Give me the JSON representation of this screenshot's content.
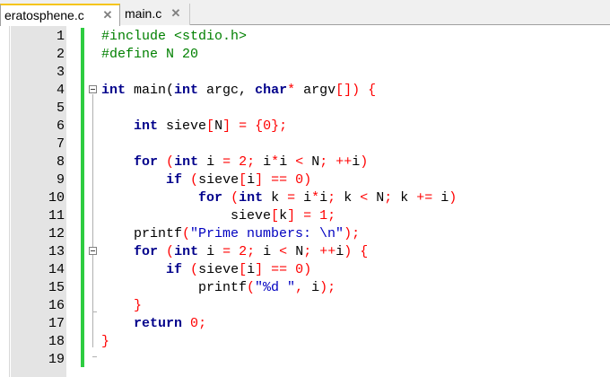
{
  "tabs": [
    {
      "label": "eratosphene.c",
      "close": "✕"
    },
    {
      "label": "main.c",
      "close": "✕"
    }
  ],
  "editor": {
    "lines": [
      {
        "n": "1",
        "tokens": [
          {
            "t": "#include <stdio.h>",
            "c": "pp"
          }
        ]
      },
      {
        "n": "2",
        "tokens": [
          {
            "t": "#define N 20",
            "c": "pp"
          }
        ]
      },
      {
        "n": "3",
        "tokens": []
      },
      {
        "n": "4",
        "tokens": [
          {
            "t": "int",
            "c": "kw"
          },
          {
            "t": " main(",
            "c": ""
          },
          {
            "t": "int",
            "c": "kw"
          },
          {
            "t": " argc, ",
            "c": ""
          },
          {
            "t": "char",
            "c": "kw"
          },
          {
            "t": "*",
            "c": "op"
          },
          {
            "t": " argv",
            "c": ""
          },
          {
            "t": "[])",
            "c": "op"
          },
          {
            "t": " ",
            "c": ""
          },
          {
            "t": "{",
            "c": "op"
          }
        ]
      },
      {
        "n": "5",
        "tokens": []
      },
      {
        "n": "6",
        "tokens": [
          {
            "t": "    ",
            "c": ""
          },
          {
            "t": "int",
            "c": "kw"
          },
          {
            "t": " sieve",
            "c": ""
          },
          {
            "t": "[",
            "c": "op"
          },
          {
            "t": "N",
            "c": ""
          },
          {
            "t": "]",
            "c": "op"
          },
          {
            "t": " ",
            "c": ""
          },
          {
            "t": "=",
            "c": "op"
          },
          {
            "t": " ",
            "c": ""
          },
          {
            "t": "{",
            "c": "op"
          },
          {
            "t": "0",
            "c": "num"
          },
          {
            "t": "};",
            "c": "op"
          }
        ]
      },
      {
        "n": "7",
        "tokens": []
      },
      {
        "n": "8",
        "tokens": [
          {
            "t": "    ",
            "c": ""
          },
          {
            "t": "for",
            "c": "kw"
          },
          {
            "t": " ",
            "c": ""
          },
          {
            "t": "(",
            "c": "op"
          },
          {
            "t": "int",
            "c": "kw"
          },
          {
            "t": " i ",
            "c": ""
          },
          {
            "t": "=",
            "c": "op"
          },
          {
            "t": " ",
            "c": ""
          },
          {
            "t": "2",
            "c": "num"
          },
          {
            "t": ";",
            "c": "op"
          },
          {
            "t": " i",
            "c": ""
          },
          {
            "t": "*",
            "c": "op"
          },
          {
            "t": "i ",
            "c": ""
          },
          {
            "t": "<",
            "c": "op"
          },
          {
            "t": " N",
            "c": ""
          },
          {
            "t": ";",
            "c": "op"
          },
          {
            "t": " ",
            "c": ""
          },
          {
            "t": "++",
            "c": "op"
          },
          {
            "t": "i",
            "c": ""
          },
          {
            "t": ")",
            "c": "op"
          }
        ]
      },
      {
        "n": "9",
        "tokens": [
          {
            "t": "        ",
            "c": ""
          },
          {
            "t": "if",
            "c": "kw"
          },
          {
            "t": " ",
            "c": ""
          },
          {
            "t": "(",
            "c": "op"
          },
          {
            "t": "sieve",
            "c": ""
          },
          {
            "t": "[",
            "c": "op"
          },
          {
            "t": "i",
            "c": ""
          },
          {
            "t": "]",
            "c": "op"
          },
          {
            "t": " ",
            "c": ""
          },
          {
            "t": "==",
            "c": "op"
          },
          {
            "t": " ",
            "c": ""
          },
          {
            "t": "0",
            "c": "num"
          },
          {
            "t": ")",
            "c": "op"
          }
        ]
      },
      {
        "n": "10",
        "tokens": [
          {
            "t": "            ",
            "c": ""
          },
          {
            "t": "for",
            "c": "kw"
          },
          {
            "t": " ",
            "c": ""
          },
          {
            "t": "(",
            "c": "op"
          },
          {
            "t": "int",
            "c": "kw"
          },
          {
            "t": " k ",
            "c": ""
          },
          {
            "t": "=",
            "c": "op"
          },
          {
            "t": " i",
            "c": ""
          },
          {
            "t": "*",
            "c": "op"
          },
          {
            "t": "i",
            "c": ""
          },
          {
            "t": ";",
            "c": "op"
          },
          {
            "t": " k ",
            "c": ""
          },
          {
            "t": "<",
            "c": "op"
          },
          {
            "t": " N",
            "c": ""
          },
          {
            "t": ";",
            "c": "op"
          },
          {
            "t": " k ",
            "c": ""
          },
          {
            "t": "+=",
            "c": "op"
          },
          {
            "t": " i",
            "c": ""
          },
          {
            "t": ")",
            "c": "op"
          }
        ]
      },
      {
        "n": "11",
        "tokens": [
          {
            "t": "                ",
            "c": ""
          },
          {
            "t": "sieve",
            "c": ""
          },
          {
            "t": "[",
            "c": "op"
          },
          {
            "t": "k",
            "c": ""
          },
          {
            "t": "]",
            "c": "op"
          },
          {
            "t": " ",
            "c": ""
          },
          {
            "t": "=",
            "c": "op"
          },
          {
            "t": " ",
            "c": ""
          },
          {
            "t": "1",
            "c": "num"
          },
          {
            "t": ";",
            "c": "op"
          }
        ]
      },
      {
        "n": "12",
        "tokens": [
          {
            "t": "    printf",
            "c": ""
          },
          {
            "t": "(",
            "c": "op"
          },
          {
            "t": "\"Prime numbers: \\n\"",
            "c": "str"
          },
          {
            "t": ");",
            "c": "op"
          }
        ]
      },
      {
        "n": "13",
        "tokens": [
          {
            "t": "    ",
            "c": ""
          },
          {
            "t": "for",
            "c": "kw"
          },
          {
            "t": " ",
            "c": ""
          },
          {
            "t": "(",
            "c": "op"
          },
          {
            "t": "int",
            "c": "kw"
          },
          {
            "t": " i ",
            "c": ""
          },
          {
            "t": "=",
            "c": "op"
          },
          {
            "t": " ",
            "c": ""
          },
          {
            "t": "2",
            "c": "num"
          },
          {
            "t": ";",
            "c": "op"
          },
          {
            "t": " i ",
            "c": ""
          },
          {
            "t": "<",
            "c": "op"
          },
          {
            "t": " N",
            "c": ""
          },
          {
            "t": ";",
            "c": "op"
          },
          {
            "t": " ",
            "c": ""
          },
          {
            "t": "++",
            "c": "op"
          },
          {
            "t": "i",
            "c": ""
          },
          {
            "t": ")",
            "c": "op"
          },
          {
            "t": " ",
            "c": ""
          },
          {
            "t": "{",
            "c": "op"
          }
        ]
      },
      {
        "n": "14",
        "tokens": [
          {
            "t": "        ",
            "c": ""
          },
          {
            "t": "if",
            "c": "kw"
          },
          {
            "t": " ",
            "c": ""
          },
          {
            "t": "(",
            "c": "op"
          },
          {
            "t": "sieve",
            "c": ""
          },
          {
            "t": "[",
            "c": "op"
          },
          {
            "t": "i",
            "c": ""
          },
          {
            "t": "]",
            "c": "op"
          },
          {
            "t": " ",
            "c": ""
          },
          {
            "t": "==",
            "c": "op"
          },
          {
            "t": " ",
            "c": ""
          },
          {
            "t": "0",
            "c": "num"
          },
          {
            "t": ")",
            "c": "op"
          }
        ]
      },
      {
        "n": "15",
        "tokens": [
          {
            "t": "            printf",
            "c": ""
          },
          {
            "t": "(",
            "c": "op"
          },
          {
            "t": "\"%d \"",
            "c": "str"
          },
          {
            "t": ",",
            "c": "op"
          },
          {
            "t": " i",
            "c": ""
          },
          {
            "t": ");",
            "c": "op"
          }
        ]
      },
      {
        "n": "16",
        "tokens": [
          {
            "t": "    ",
            "c": ""
          },
          {
            "t": "}",
            "c": "op"
          }
        ]
      },
      {
        "n": "17",
        "tokens": [
          {
            "t": "    ",
            "c": ""
          },
          {
            "t": "return",
            "c": "kw"
          },
          {
            "t": " ",
            "c": ""
          },
          {
            "t": "0",
            "c": "num"
          },
          {
            "t": ";",
            "c": "op"
          }
        ]
      },
      {
        "n": "18",
        "tokens": [
          {
            "t": "}",
            "c": "op"
          }
        ]
      },
      {
        "n": "19",
        "tokens": []
      }
    ]
  },
  "colors": {
    "keyword": "#00008b",
    "preprocessor": "#008000",
    "string": "#0000c0",
    "number": "#ff0000",
    "operator": "#ff0000",
    "change_bar": "#2ecc40",
    "active_tab_accent": "#f5c518"
  }
}
